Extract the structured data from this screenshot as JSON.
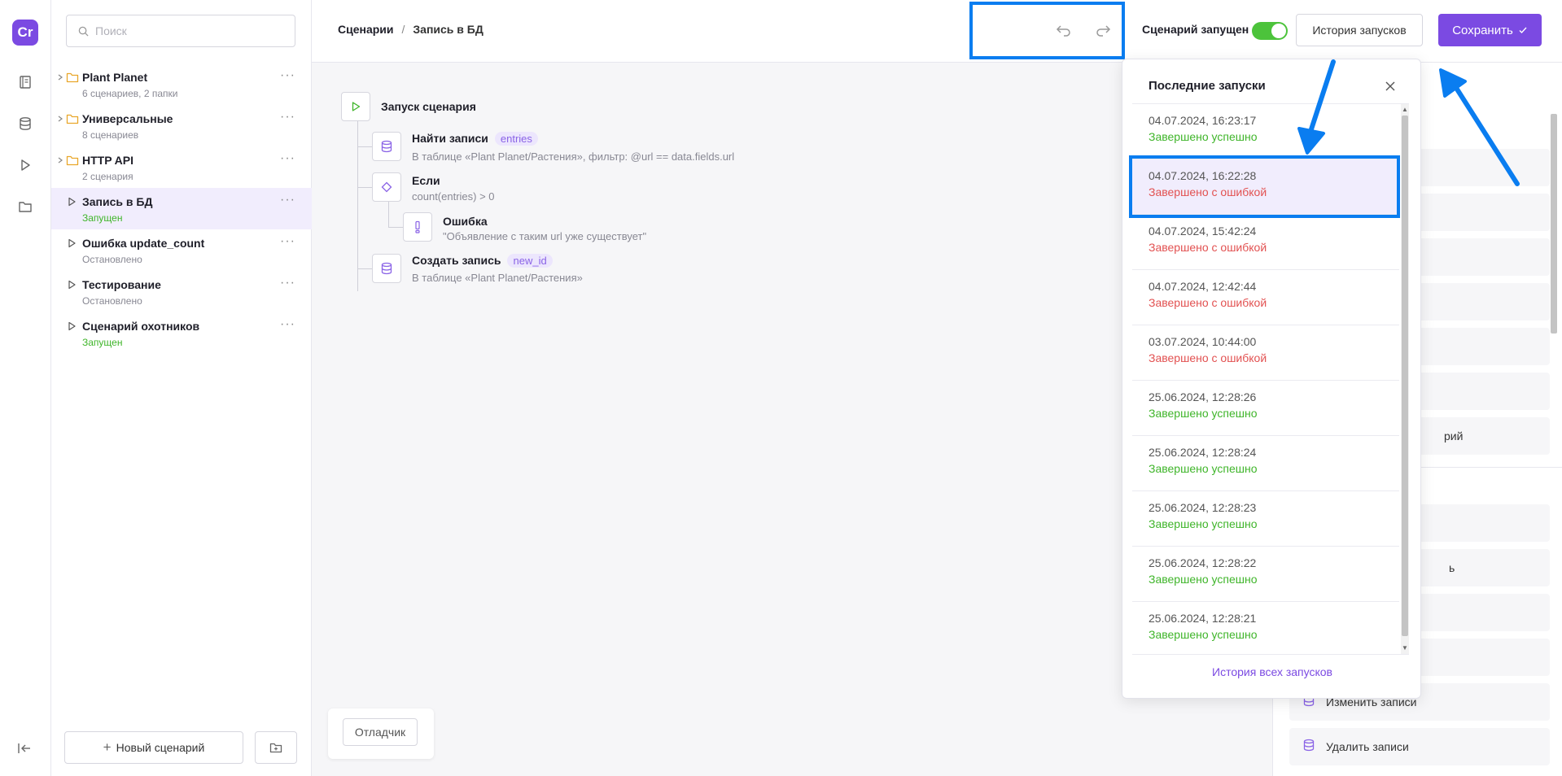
{
  "rail": {
    "logo": "Cr",
    "icons": [
      "book-icon",
      "database-icon",
      "play-icon",
      "folder-icon",
      "logout-icon"
    ]
  },
  "sidebar": {
    "search_placeholder": "Поиск",
    "items": [
      {
        "title": "Plant Planet",
        "sub": "6 сценариев, 2 папки",
        "type": "folder"
      },
      {
        "title": "Универсальные",
        "sub": "8 сценариев",
        "type": "folder"
      },
      {
        "title": "HTTP API",
        "sub": "2 сценария",
        "type": "folder"
      },
      {
        "title": "Запись в БД",
        "sub": "Запущен",
        "type": "scenario",
        "status": "running"
      },
      {
        "title": "Ошибка update_count",
        "sub": "Остановлено",
        "type": "scenario"
      },
      {
        "title": "Тестирование",
        "sub": "Остановлено",
        "type": "scenario"
      },
      {
        "title": "Сценарий охотников",
        "sub": "Запущен",
        "type": "scenario",
        "status": "running"
      }
    ],
    "new_scenario": "Новый сценарий"
  },
  "header": {
    "crumb_root": "Сценарии",
    "crumb_sep": "/",
    "crumb_current": "Запись в БД",
    "run_label": "Сценарий запущен",
    "history_button": "История запусков",
    "save_button": "Сохранить"
  },
  "flow": {
    "start": "Запуск сценария",
    "find_title": "Найти записи",
    "find_tag": "entries",
    "find_sub": "В таблице «Plant Planet/Растения», фильтр: @url == data.fields.url",
    "if_title": "Если",
    "if_sub": "count(entries) > 0",
    "error_title": "Ошибка",
    "error_sub": "\"Объявление с таким url уже существует\"",
    "create_title": "Создать запись",
    "create_tag": "new_id",
    "create_sub": "В таблице «Plant Planet/Растения»"
  },
  "debugger_button": "Отладчик",
  "right_panel": {
    "partial_texts": [
      "рий",
      "ь"
    ],
    "edit_records": "Изменить записи",
    "delete_records": "Удалить записи"
  },
  "popup": {
    "title": "Последние запуски",
    "runs": [
      {
        "time": "04.07.2024, 16:23:17",
        "status": "Завершено успешно",
        "ok": true
      },
      {
        "time": "04.07.2024, 16:22:28",
        "status": "Завершено с ошибкой",
        "ok": false
      },
      {
        "time": "04.07.2024, 15:42:24",
        "status": "Завершено с ошибкой",
        "ok": false
      },
      {
        "time": "04.07.2024, 12:42:44",
        "status": "Завершено с ошибкой",
        "ok": false
      },
      {
        "time": "03.07.2024, 10:44:00",
        "status": "Завершено с ошибкой",
        "ok": false
      },
      {
        "time": "25.06.2024, 12:28:26",
        "status": "Завершено успешно",
        "ok": true
      },
      {
        "time": "25.06.2024, 12:28:24",
        "status": "Завершено успешно",
        "ok": true
      },
      {
        "time": "25.06.2024, 12:28:23",
        "status": "Завершено успешно",
        "ok": true
      },
      {
        "time": "25.06.2024, 12:28:22",
        "status": "Завершено успешно",
        "ok": true
      },
      {
        "time": "25.06.2024, 12:28:21",
        "status": "Завершено успешно",
        "ok": true
      }
    ],
    "all_runs_link": "История всех запусков"
  },
  "colors": {
    "accent": "#7b4ae2",
    "success": "#3fb52a",
    "error": "#e25151",
    "annotation": "#0a7df0"
  }
}
